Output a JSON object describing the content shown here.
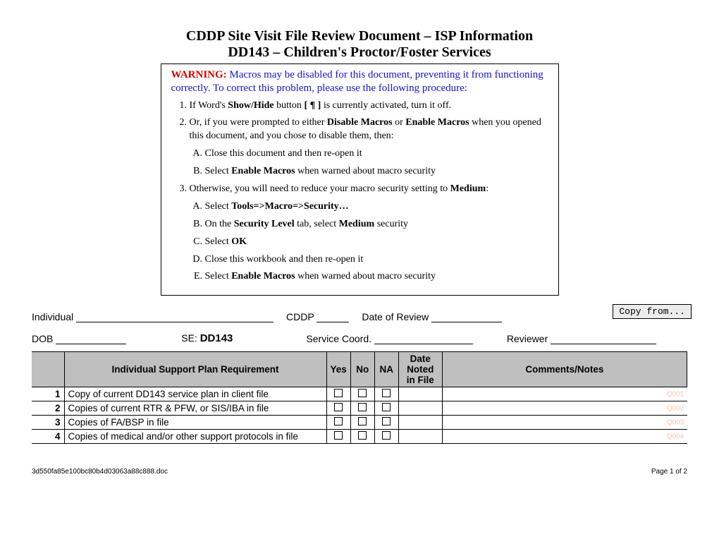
{
  "title_line1": "CDDP Site Visit File Review Document – ISP Information",
  "title_line2": "DD143 – Children's Proctor/Foster Services",
  "warning": {
    "label": "WARNING:",
    "intro": " Macros may be disabled for this document, preventing it from functioning correctly.  To correct this problem, please use the following procedure:",
    "item1_pre": "If Word's ",
    "item1_b1": "Show/Hide",
    "item1_mid": " button ",
    "item1_b2": "[ ¶ ]",
    "item1_post": " is currently activated, turn it off.",
    "item2_pre": "Or, if you were prompted to either ",
    "item2_b1": "Disable Macros",
    "item2_mid": " or ",
    "item2_b2": "Enable Macros",
    "item2_post": " when you opened this document, and you chose to disable them, then:",
    "item2a": "Close this document and then re-open it",
    "item2b_pre": "Select ",
    "item2b_b": "Enable Macros",
    "item2b_post": " when warned about macro security",
    "item3_pre": "Otherwise, you will need to reduce your macro security setting to ",
    "item3_b": "Medium",
    "item3_post": ":",
    "item3a_pre": "Select ",
    "item3a_b": "Tools=>Macro=>Security…",
    "item3b_pre": "On the ",
    "item3b_b1": "Security Level",
    "item3b_mid": " tab, select ",
    "item3b_b2": "Medium",
    "item3b_post": " security",
    "item3c_pre": "Select ",
    "item3c_b": "OK",
    "item3d": "Close this workbook and then re-open it",
    "item3e_pre": "Select ",
    "item3e_b": "Enable Macros",
    "item3e_post": " when warned about macro security"
  },
  "fields": {
    "individual": "Individual",
    "cddp": "CDDP",
    "date_of_review": "Date of Review",
    "dob": "DOB",
    "se_label": "SE:",
    "se_value": "DD143",
    "service_coord": "Service Coord.",
    "reviewer": "Reviewer"
  },
  "copy_button": "Copy from...",
  "table": {
    "headers": {
      "requirement": "Individual Support Plan Requirement",
      "yes": "Yes",
      "no": "No",
      "na": "NA",
      "date": "Date Noted in File",
      "comments": "Comments/Notes"
    },
    "rows": [
      {
        "num": "1",
        "req": "Copy of current DD143 service plan in client file",
        "code": "Q001"
      },
      {
        "num": "2",
        "req": "Copies of current RTR & PFW, or SIS/IBA in file",
        "code": "Q002"
      },
      {
        "num": "3",
        "req": "Copies of FA/BSP in file",
        "code": "Q003"
      },
      {
        "num": "4",
        "req": "Copies of medical and/or other support protocols in file",
        "code": "Q004"
      }
    ]
  },
  "footer": {
    "filename": "3d550fa85e100bc80b4d03063a88c888.doc",
    "page": "Page 1 of 2"
  }
}
